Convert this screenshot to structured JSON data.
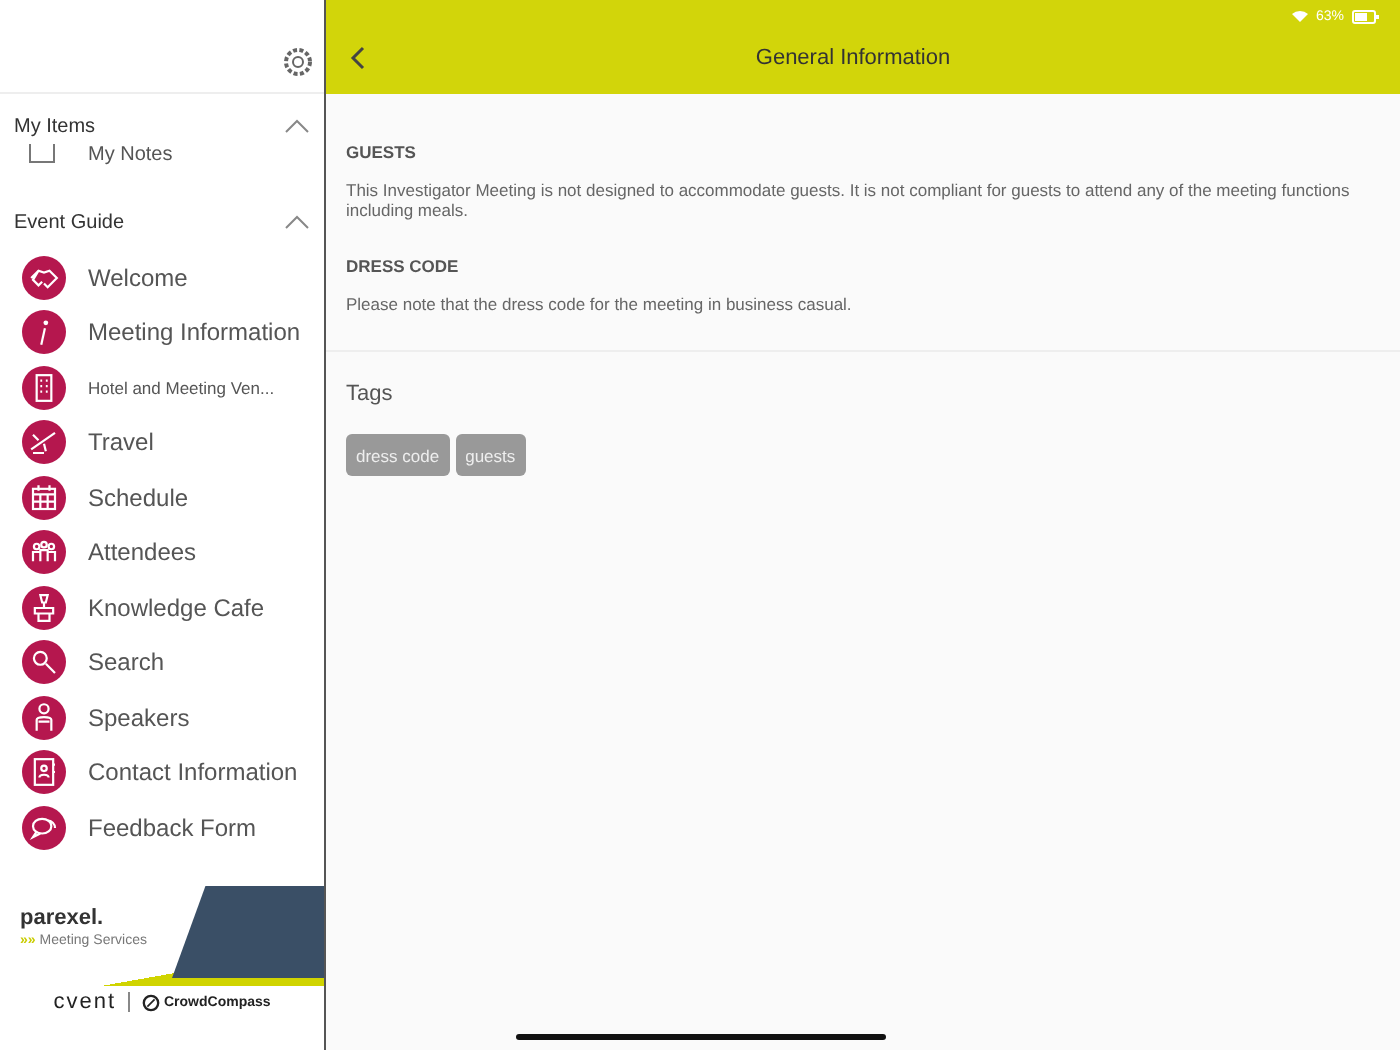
{
  "sidebar": {
    "sections": [
      {
        "title": "My Items",
        "expanded": true,
        "items": [
          {
            "label": "My Notes"
          }
        ]
      },
      {
        "title": "Event Guide",
        "expanded": true,
        "items": [
          {
            "label": "Welcome"
          },
          {
            "label": "Meeting Information"
          },
          {
            "label": "Hotel and Meeting Ven..."
          },
          {
            "label": "Travel"
          },
          {
            "label": "Schedule"
          },
          {
            "label": "Attendees"
          },
          {
            "label": "Knowledge Cafe"
          },
          {
            "label": "Search"
          },
          {
            "label": "Speakers"
          },
          {
            "label": "Contact Information"
          },
          {
            "label": "Feedback Form"
          }
        ]
      }
    ],
    "banner": {
      "brand": "parexel.",
      "tagline_mark": "»»",
      "tagline": "Meeting Services"
    },
    "footer": {
      "logo_left": "cvent",
      "logo_right": "CrowdCompass"
    }
  },
  "status_bar": {
    "battery": "63%"
  },
  "header": {
    "title": "General Information"
  },
  "content": {
    "sections": [
      {
        "heading": "GUESTS",
        "body": "This Investigator Meeting is not designed to accommodate guests. It is not compliant for guests to attend any of the meeting functions including meals."
      },
      {
        "heading": "DRESS CODE",
        "body": "Please note that the dress code for the meeting in business casual."
      }
    ],
    "tags_title": "Tags",
    "tags": [
      "dress code",
      "guests"
    ]
  }
}
